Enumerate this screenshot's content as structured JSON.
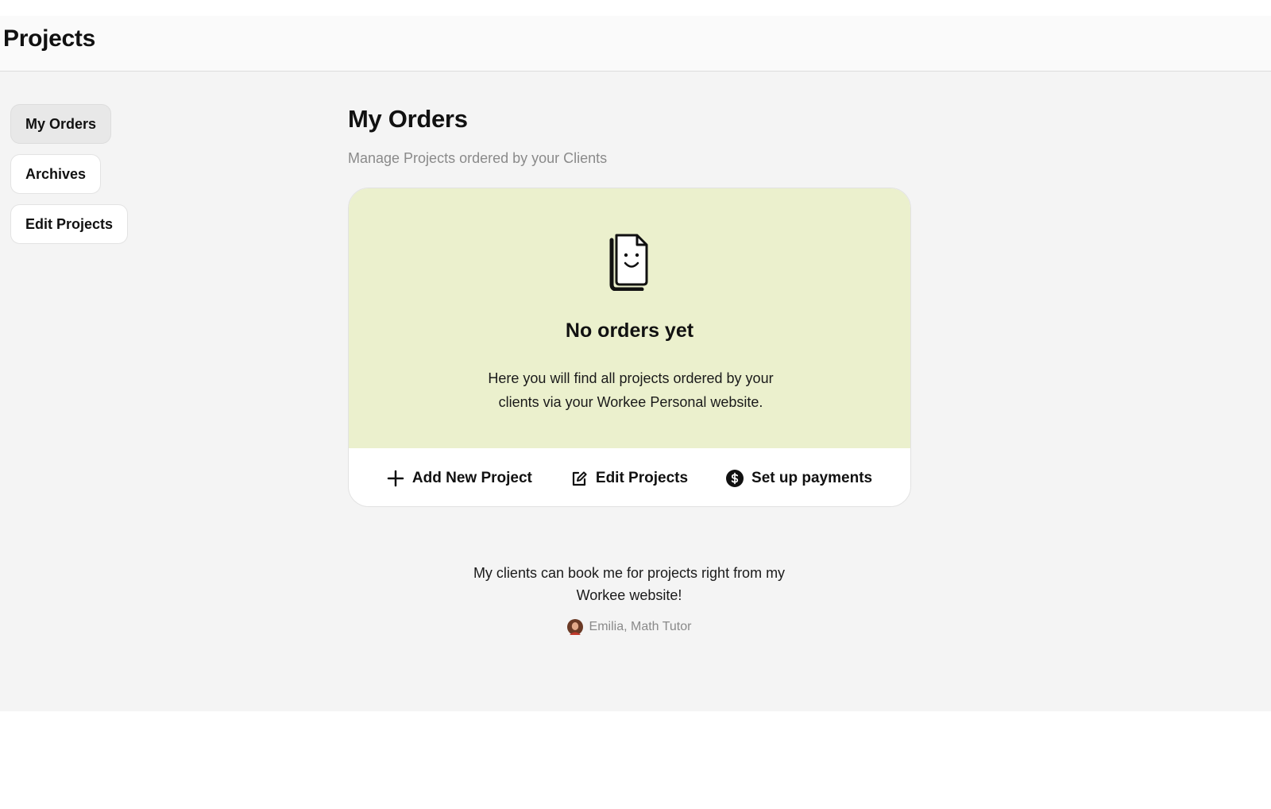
{
  "header": {
    "title": "Projects"
  },
  "sidebar": {
    "items": [
      {
        "label": "My Orders",
        "active": true
      },
      {
        "label": "Archives",
        "active": false
      },
      {
        "label": "Edit Projects",
        "active": false
      }
    ]
  },
  "main": {
    "title": "My Orders",
    "subtitle": "Manage Projects ordered by your Clients",
    "empty_state": {
      "icon": "smiling-document-icon",
      "title": "No orders yet",
      "description": "Here you will find all projects ordered by your clients via your Workee Personal website.",
      "background_color": "#ebf0cd"
    },
    "actions": [
      {
        "label": "Add New Project",
        "icon": "plus-icon"
      },
      {
        "label": "Edit Projects",
        "icon": "edit-icon"
      },
      {
        "label": "Set up payments",
        "icon": "dollar-icon"
      }
    ]
  },
  "testimonial": {
    "quote": "My clients can book me for projects right from my Workee website!",
    "author": "Emilia, Math Tutor",
    "avatar": "avatar"
  }
}
